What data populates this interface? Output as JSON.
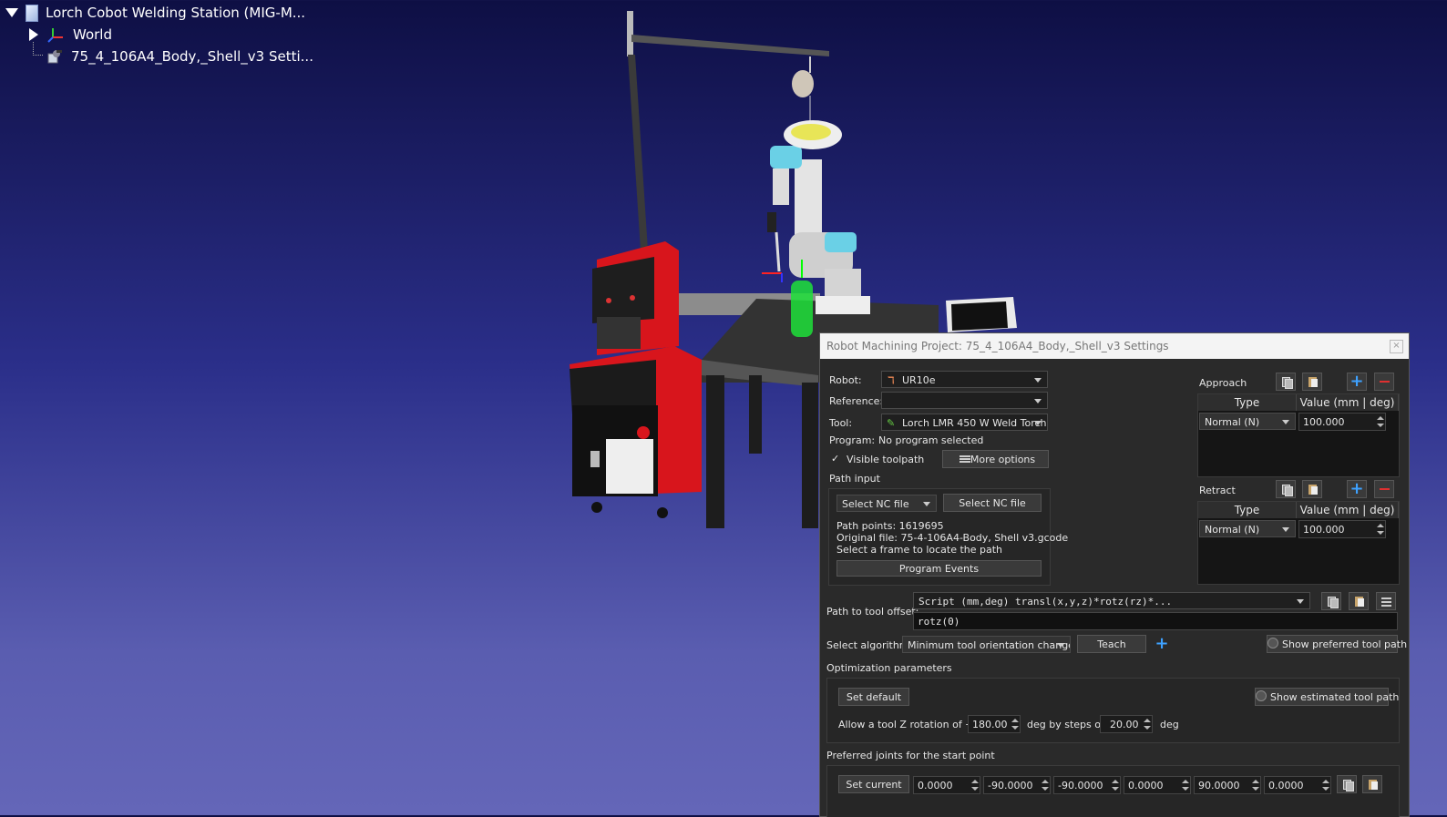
{
  "tree": {
    "station": "Lorch Cobot Welding Station (MIG-M...",
    "world": "World",
    "project": "75_4_106A4_Body,_Shell_v3 Setti..."
  },
  "panel": {
    "title": "Robot Machining Project: 75_4_106A4_Body,_Shell_v3 Settings",
    "close": "×",
    "robot_label": "Robot:",
    "robot_value": "UR10e",
    "reference_label": "Reference:",
    "reference_value": "",
    "tool_label": "Tool:",
    "tool_value": "Lorch LMR 450 W Weld Torch",
    "program_label": "Program:",
    "program_value": "No program selected",
    "visible_toolpath": "Visible toolpath",
    "visible_toolpath_check": "✓",
    "more_options": "More options",
    "path_input_title": "Path input",
    "select_nc_combo": "Select NC file",
    "select_nc_button": "Select NC file",
    "path_points": "Path points: 1619695",
    "original_file": "Original file: 75-4-106A4-Body, Shell v3.gcode",
    "select_frame": "Select a frame to locate the path",
    "program_events": "Program Events",
    "approach_label": "Approach",
    "retract_label": "Retract",
    "col_type": "Type",
    "col_value": "Value (mm | deg)",
    "approach_type": "Normal (N)",
    "approach_value": "100.000",
    "retract_type": "Normal (N)",
    "retract_value": "100.000",
    "path_offset_label": "Path to tool offset:",
    "path_offset_combo": "Script (mm,deg) transl(x,y,z)*rotz(rz)*...",
    "path_offset_value": "rotz(0)",
    "select_algorithm_label": "Select algorithm:",
    "algorithm_value": "Minimum tool orientation change",
    "teach": "Teach",
    "show_preferred": "Show preferred tool path",
    "optimization_title": "Optimization parameters",
    "set_default": "Set default",
    "show_estimated": "Show estimated tool path",
    "allow_rotation": "Allow a tool Z rotation of +/-",
    "rotation_value": "180.00",
    "deg_by_steps": "deg by steps of",
    "steps_value": "20.00",
    "deg": "deg",
    "preferred_joints_title": "Preferred joints for the start point",
    "set_current": "Set current",
    "joints": [
      "0.0000",
      "-90.0000",
      "-90.0000",
      "0.0000",
      "90.0000",
      "0.0000"
    ]
  },
  "colors": {
    "accent_plus": "#3ea1ff",
    "remove_red": "#e03030",
    "panel_bg": "#2a2a2a"
  }
}
